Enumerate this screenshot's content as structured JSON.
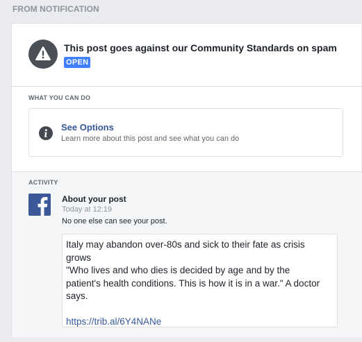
{
  "header": {
    "label": "FROM NOTIFICATION"
  },
  "notice": {
    "icon": "warning-icon",
    "title": "This post goes against our Community Standards on spam",
    "badge": "OPEN",
    "badge_color": "#4080ff"
  },
  "what_you_can_do": {
    "label": "WHAT YOU CAN DO",
    "options": {
      "icon": "info-icon",
      "title": "See Options",
      "description": "Learn more about this post and see what you can do"
    }
  },
  "activity": {
    "label": "ACTIVITY",
    "icon": "facebook-logo-icon",
    "title": "About your post",
    "time": "Today at 12:19",
    "note": "No one else can see your post.",
    "post": {
      "lines": [
        "Italy may abandon over-80s and sick to their fate as crisis",
        "grows",
        "\"Who lives and who dies is decided by age and by the",
        "patient's health conditions. This is how it is in a war.\" A doctor",
        "says."
      ],
      "link": "https://trib.al/6Y4NANe"
    }
  },
  "colors": {
    "page_bg": "#e9ebee",
    "link": "#365899",
    "facebook_blue": "#3b5998"
  }
}
